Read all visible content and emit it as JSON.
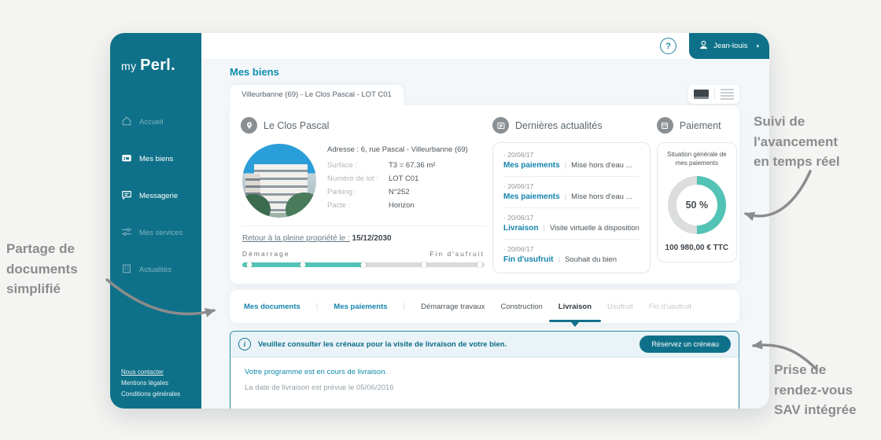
{
  "annotations": {
    "tracking": "Suivi de\nl'avancement\nen temps réel",
    "documents": "Partage de\ndocuments\nsimplifié",
    "appointment": "Prise de\nrendez-vous\nSAV intégrée"
  },
  "sidebar": {
    "logo_prefix": "my",
    "logo_brand": "Perl.",
    "items": [
      {
        "label": "Accueil",
        "icon": "home-icon"
      },
      {
        "label": "Mes biens",
        "icon": "wallet-icon"
      },
      {
        "label": "Messagerie",
        "icon": "chat-icon"
      },
      {
        "label": "Mes services",
        "icon": "sliders-icon"
      },
      {
        "label": "Actualités",
        "icon": "building-icon"
      }
    ],
    "footer_links": [
      "Nous contacter",
      "Mentions légales",
      "Conditions générales"
    ]
  },
  "topbar": {
    "username": "Jean-louis"
  },
  "main": {
    "page_title": "Mes biens",
    "property_tab": "Villeurbanne (69) - Le Clos Pascal - LOT C01"
  },
  "property": {
    "name": "Le Clos Pascal",
    "address_line": "Adresse : 6, rue Pascal - Villeurbanne (69)",
    "details": [
      {
        "label": "Surface :",
        "value": "T3 = 67.36 m²"
      },
      {
        "label": "Numéro de lot :",
        "value": "LOT C01"
      },
      {
        "label": "Parking :",
        "value": "N°252"
      },
      {
        "label": "Pacte :",
        "value": "Horizon"
      }
    ],
    "return_label": "Retour à la pleine propriété le :",
    "return_date": "15/12/2030",
    "progress": {
      "start_label": "Démarrage",
      "end_label": "Fin d'sufruit",
      "percent": 50
    }
  },
  "news": {
    "title": "Dernières actualités",
    "items": [
      {
        "date": "20/06/17",
        "category": "Mes paiements",
        "text": "Mise hors d'eau ..."
      },
      {
        "date": "20/06/17",
        "category": "Mes paiements",
        "text": "Mise hors d'eau ..."
      },
      {
        "date": "20/06/17",
        "category": "Livraison",
        "text": "Visite virtuelle à disposition"
      },
      {
        "date": "20/06/17",
        "category": "Fin d'usufruit",
        "text": "Souhait du bien"
      }
    ]
  },
  "payment": {
    "title": "Paiement",
    "card_title": "Situation générale de mes paiements",
    "percent_label": "50 %",
    "percent": 50,
    "amount": "100 980,00 € TTC"
  },
  "tabs": {
    "items": [
      {
        "label": "Mes documents"
      },
      {
        "label": "Mes paiements"
      },
      {
        "label": "Démarrage travaux"
      },
      {
        "label": "Construction"
      },
      {
        "label": "Livraison"
      },
      {
        "label": "Usufruit"
      },
      {
        "label": "Fin d'usufruit"
      }
    ],
    "active": "Livraison"
  },
  "info": {
    "message": "Veuillez consulter les crénaux pour la visite de livraison de votre bien.",
    "button_label": "Réservez un créneau",
    "status_line": "Votre programme est en cours de livraison.",
    "date_line": "La date de livraison est prévue le 05/06/2016"
  },
  "icons": {
    "help": "?",
    "caret": "▾",
    "info": "i",
    "bullet": "·",
    "separator": "|"
  },
  "colors": {
    "sidebar": "#0f7189",
    "accent": "#52c3b5",
    "donut_rest": "#dcdddd",
    "link": "#0e8cae",
    "annotation": "#8c8c8c"
  }
}
